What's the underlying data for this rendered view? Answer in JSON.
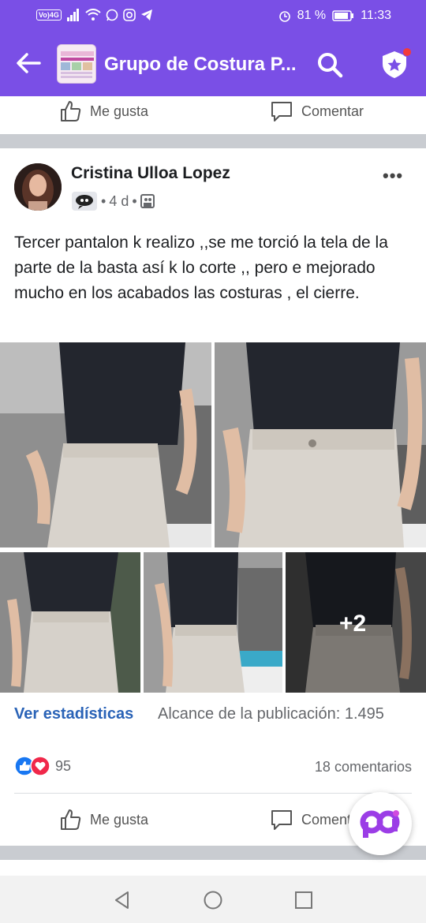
{
  "status": {
    "volte": "Vo)4G",
    "battery_pct": "81 %",
    "time": "11:33"
  },
  "appbar": {
    "title": "Grupo de Costura P...",
    "thumb_text_1": "HORARIO",
    "thumb_text_2": "PRESENCIAL ACADEMY"
  },
  "top_actions": {
    "like_label": "Me gusta",
    "comment_label": "Comentar"
  },
  "post": {
    "author": "Cristina Ulloa Lopez",
    "time_ago": "4 d",
    "text": "Tercer pantalon k realizo ,,se me torció la tela de la parte de la basta así k lo corte ,, pero e mejorado mucho en los acabados las costuras , el cierre.",
    "extra_photos": "+2",
    "stats_link": "Ver estadísticas",
    "reach": "Alcance de la publicación: 1.495",
    "reaction_count": "95",
    "comment_count": "18 comentarios",
    "like_label": "Me gusta",
    "comment_label": "Comentar"
  },
  "colors": {
    "accent": "#7a4fe6",
    "link": "#2a63b7",
    "like_blue": "#1877f2",
    "love_red": "#f0284a"
  }
}
